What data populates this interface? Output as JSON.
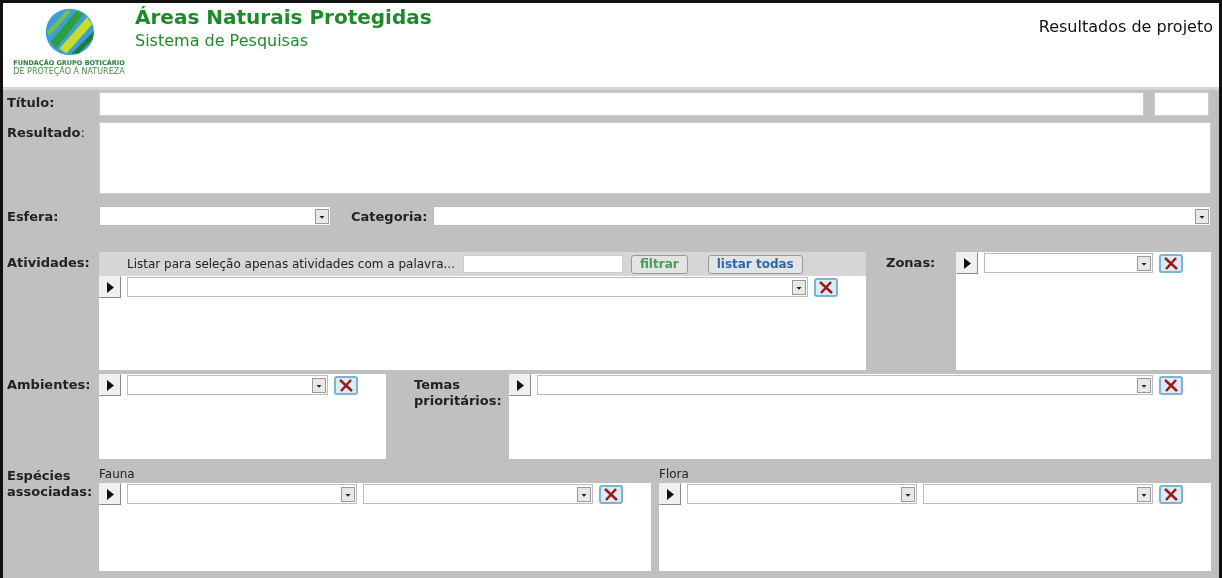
{
  "header": {
    "logo_name": "FUNDAÇÃO GRUPO BOTICÁRIO",
    "logo_tagline": "DE PROTEÇÃO À NATUREZA",
    "title": "Áreas Naturais Protegidas",
    "subtitle": "Sistema de Pesquisas",
    "page_title": "Resultados de projeto"
  },
  "titulo": {
    "label": "Título:"
  },
  "resultado": {
    "label": "**Resultado**:"
  },
  "esfera": {
    "label": "Esfera:"
  },
  "categoria": {
    "label": "Categoria:"
  },
  "atividades": {
    "label": "Atividades:",
    "filter_prompt": "Listar para seleção apenas atividades com a palavra...",
    "buttons": [
      {
        "label": "filtrar",
        "kind": "filter"
      },
      {
        "label": "listar todas",
        "kind": "list_all"
      }
    ]
  },
  "zonas": {
    "label": "Zonas:"
  },
  "ambientes": {
    "label": "Ambientes:"
  },
  "temas": {
    "label": "Temas prioritários:"
  },
  "especies": {
    "label": "Espécies associadas:",
    "groups": [
      {
        "label": "Fauna"
      },
      {
        "label": "Flora"
      }
    ]
  }
}
